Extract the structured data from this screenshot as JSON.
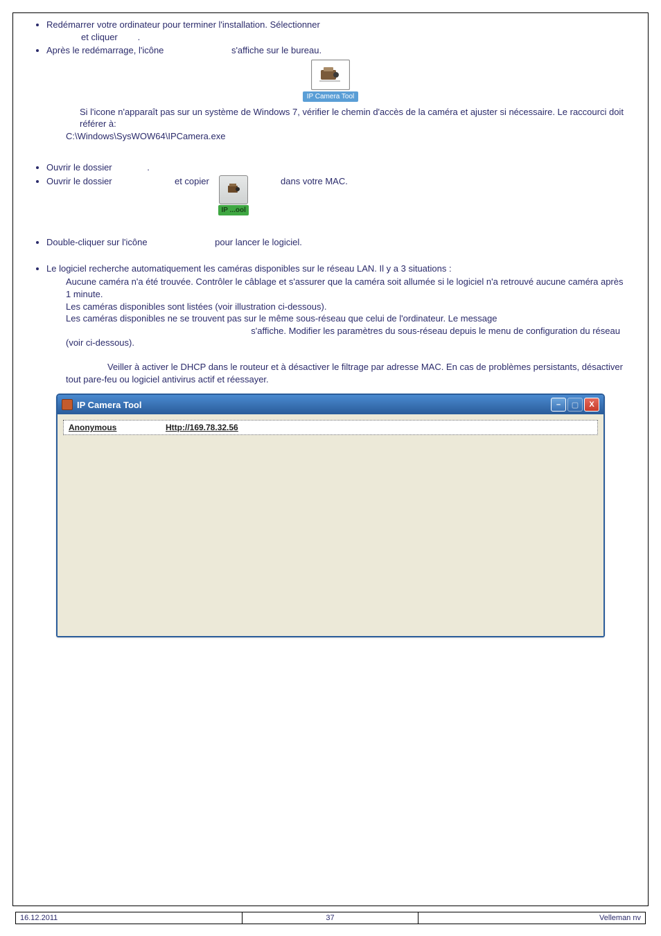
{
  "bullets": {
    "b1_a": "Redémarrer votre ordinateur pour terminer l'installation. Sélectionner",
    "b1_b": "et cliquer",
    "b2_a": "Après le redémarrage, l'icône",
    "b2_b": "s'affiche sur le bureau.",
    "b3": "Ouvrir le dossier",
    "b4_a": "Ouvrir le dossier",
    "b4_b": "et copier",
    "b4_c": "dans votre MAC.",
    "b5_a": "Double-cliquer sur l'icône",
    "b5_b": "pour lancer le logiciel.",
    "b6": "Le logiciel recherche automatiquement les caméras disponibles sur le réseau LAN. Il y a 3 situations :"
  },
  "icon": {
    "caption": "IP Camera Tool",
    "mac_label": "IP ...ool"
  },
  "note1_a": "Si l'icone n'apparaît pas sur un système de Windows 7, vérifier le chemin d'accès de la caméra et ajuster si nécessaire. Le raccourci doit référer à:",
  "note1_b": "C:\\Windows\\SysWOW64\\IPCamera.exe",
  "situations": {
    "s1": "Aucune caméra n'a été trouvée. Contrôler le câblage et s'assurer que la caméra soit allumée si le logiciel n'a retrouvé aucune caméra après 1 minute.",
    "s2": "Les caméras disponibles sont listées (voir illustration ci-dessous).",
    "s3_a": "Les caméras disponibles ne se trouvent pas sur le même sous-réseau que celui de l'ordinateur. Le message",
    "s3_b": "s'affiche. Modifier les paramètres du sous-réseau depuis le menu de configuration du réseau (voir ci-dessous).",
    "note_a": "Veiller à activer le DHCP dans le routeur et à désactiver le filtrage par adresse MAC. En cas de problèmes persistants, désactiver tout pare-feu ou logiciel antivirus actif et réessayer."
  },
  "ipcwin": {
    "title": "IP Camera Tool",
    "row_name": "Anonymous",
    "row_url": "Http://169.78.32.56"
  },
  "winbtns": {
    "min": "–",
    "max": "▢",
    "close": "X"
  },
  "footer": {
    "date": "16.12.2011",
    "page": "37",
    "company": "Velleman nv"
  }
}
